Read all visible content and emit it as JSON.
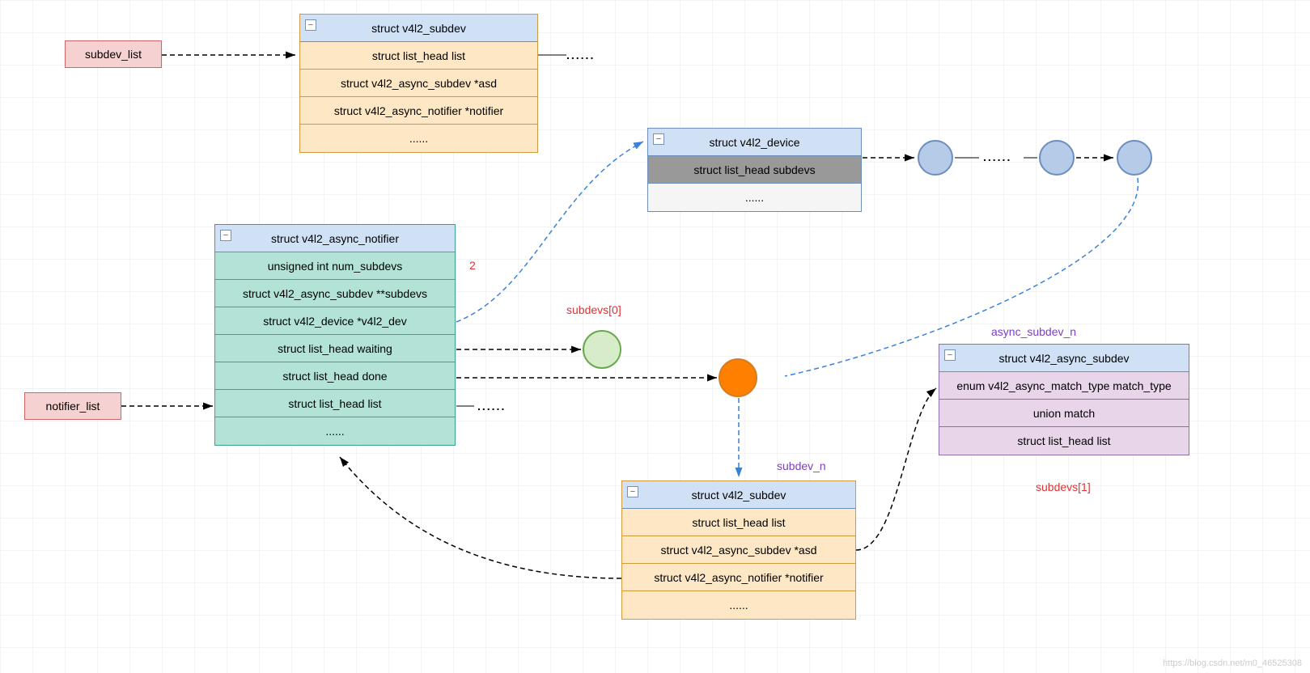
{
  "boxes": {
    "subdev_list": "subdev_list",
    "notifier_list": "notifier_list"
  },
  "subdev1": {
    "title": "struct v4l2_subdev",
    "rows": [
      "struct list_head list",
      "struct v4l2_async_subdev *asd",
      "struct v4l2_async_notifier *notifier",
      "......"
    ]
  },
  "notifier": {
    "title": "struct v4l2_async_notifier",
    "rows": [
      "unsigned int num_subdevs",
      "struct v4l2_async_subdev **subdevs",
      "struct v4l2_device *v4l2_dev",
      "struct list_head waiting",
      "struct list_head done",
      "struct list_head list",
      "......"
    ]
  },
  "device": {
    "title": "struct v4l2_device",
    "rows": [
      "struct list_head subdevs",
      "......"
    ]
  },
  "subdev2": {
    "title": "struct v4l2_subdev",
    "rows": [
      "struct list_head list",
      "struct v4l2_async_subdev *asd",
      "struct v4l2_async_notifier *notifier",
      "......"
    ]
  },
  "async_subdev": {
    "title": "struct v4l2_async_subdev",
    "rows": [
      "enum v4l2_async_match_type match_type",
      "union match",
      "struct list_head list"
    ]
  },
  "labels": {
    "num": "2",
    "subdevs0": "subdevs[0]",
    "subdevs1": "subdevs[1]",
    "subdev_n": "subdev_n",
    "async_subdev_n": "async_subdev_n",
    "dots": "......",
    "watermark": "https://blog.csdn.net/m0_46525308"
  },
  "collapse_glyph": "−"
}
